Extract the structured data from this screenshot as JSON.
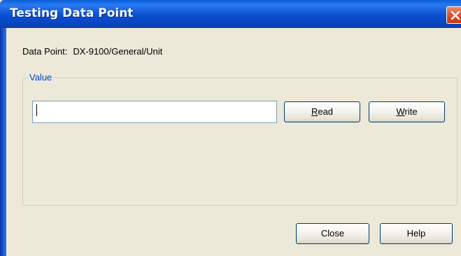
{
  "window": {
    "title": "Testing Data Point"
  },
  "data_point": {
    "label": "Data Point:",
    "value": "DX-9100/General/Unit"
  },
  "value_group": {
    "legend": "Value",
    "input_value": "",
    "read_button": {
      "mnemonic": "R",
      "rest": "ead"
    },
    "write_button": {
      "mnemonic": "W",
      "rest": "rite"
    }
  },
  "footer": {
    "close_label": "Close",
    "help_label": "Help"
  },
  "colors": {
    "title_bar": "#0a4fd0",
    "close_button": "#d94b25",
    "dialog_face": "#ece9d8",
    "legend_text": "#0046d5"
  },
  "icons": {
    "title_close": "close-icon"
  }
}
